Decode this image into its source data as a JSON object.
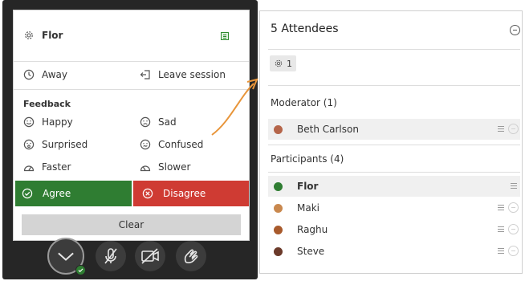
{
  "menu": {
    "user_name": "Flor",
    "away_label": "Away",
    "leave_label": "Leave session",
    "feedback_heading": "Feedback",
    "feedback_items": [
      {
        "label": "Happy",
        "icon": "happy-face-icon"
      },
      {
        "label": "Sad",
        "icon": "sad-face-icon"
      },
      {
        "label": "Surprised",
        "icon": "surprised-face-icon"
      },
      {
        "label": "Confused",
        "icon": "confused-face-icon"
      },
      {
        "label": "Faster",
        "icon": "faster-icon"
      },
      {
        "label": "Slower",
        "icon": "slower-icon"
      }
    ],
    "agree_label": "Agree",
    "disagree_label": "Disagree",
    "clear_label": "Clear"
  },
  "attendees": {
    "title": "5 Attendees",
    "status_count": "1",
    "moderator_heading": "Moderator (1)",
    "moderators": [
      {
        "name": "Beth Carlson",
        "avatar_color": "#b5654a"
      }
    ],
    "participants_heading": "Participants (4)",
    "participants": [
      {
        "name": "Flor",
        "avatar_color": "#2f7d32"
      },
      {
        "name": "Maki",
        "avatar_color": "#c9884e"
      },
      {
        "name": "Raghu",
        "avatar_color": "#a85a2c"
      },
      {
        "name": "Steve",
        "avatar_color": "#6b3a2a"
      }
    ]
  },
  "colors": {
    "agree": "#2f7d32",
    "disagree": "#cf3b33",
    "arrow": "#e8953a",
    "panel_dark": "#262626"
  }
}
